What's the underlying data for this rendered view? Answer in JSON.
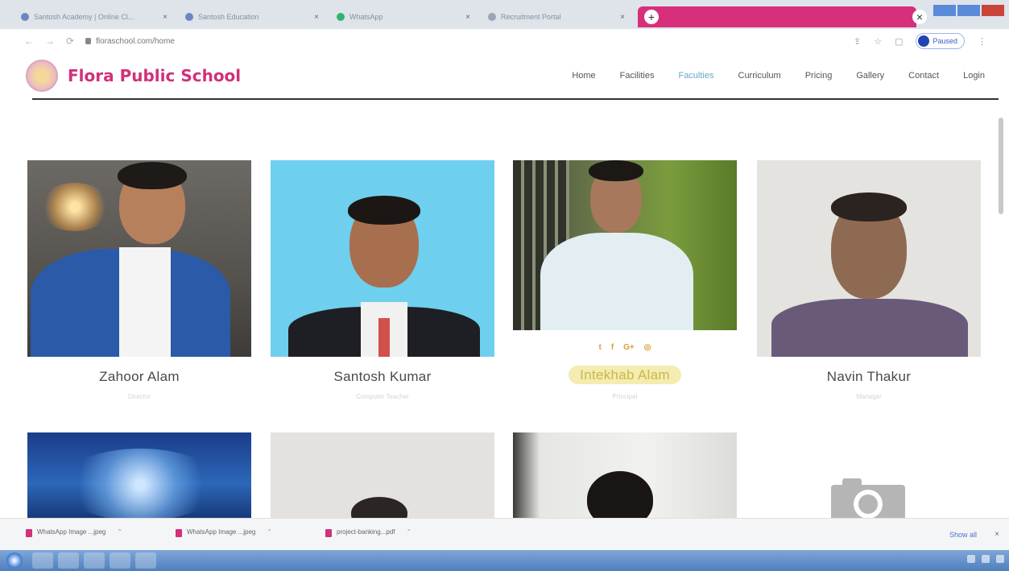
{
  "browser": {
    "tabs": [
      {
        "label": "Santosh Academy | Online Cl..."
      },
      {
        "label": "Santosh Education"
      },
      {
        "label": "WhatsApp"
      },
      {
        "label": "Recruitment Portal"
      }
    ],
    "active_tab_label": "",
    "url": "floraschool.com/home"
  },
  "profile": {
    "label": "Paused"
  },
  "site": {
    "brand": "Flora Public School",
    "nav": [
      {
        "label": "Home"
      },
      {
        "label": "Facilities"
      },
      {
        "label": "Faculties"
      },
      {
        "label": "Curriculum"
      },
      {
        "label": "Pricing"
      },
      {
        "label": "Gallery"
      },
      {
        "label": "Contact"
      },
      {
        "label": "Login"
      }
    ],
    "active_nav": "Faculties"
  },
  "faculty": [
    {
      "name": "Zahoor Alam",
      "role": "Director"
    },
    {
      "name": "Santosh Kumar",
      "role": "Computer Teacher"
    },
    {
      "name": "Intekhab Alam",
      "role": "Principal"
    },
    {
      "name": "Navin Thakur",
      "role": "Manager"
    }
  ],
  "socials": [
    "twitter",
    "facebook",
    "google-plus",
    "instagram"
  ],
  "socials_glyphs": [
    "t",
    "f",
    "G+",
    "◎"
  ],
  "downloads": [
    {
      "name": "WhatsApp Image ...jpeg",
      "sub": ""
    },
    {
      "name": "WhatsApp Image ...jpeg",
      "sub": ""
    },
    {
      "name": "project-banking...pdf",
      "sub": ""
    }
  ],
  "downloads_show_all": "Show all",
  "colors": {
    "brand": "#d2307a",
    "active_nav": "#6aa6c9",
    "highlight": "#f4ecb0"
  }
}
